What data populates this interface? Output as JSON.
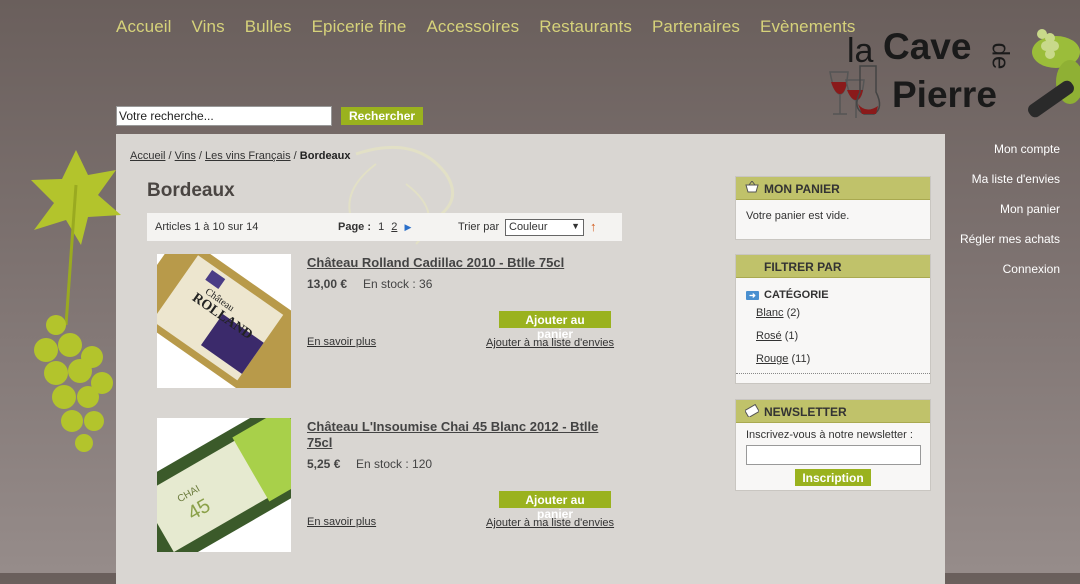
{
  "nav": [
    "Accueil",
    "Vins",
    "Bulles",
    "Epicerie fine",
    "Accessoires",
    "Restaurants",
    "Partenaires",
    "Evènements"
  ],
  "logo": {
    "la": "la",
    "cave": "Cave",
    "de": "de",
    "pierre": "Pierre"
  },
  "search": {
    "value": "Votre recherche...",
    "button": "Rechercher"
  },
  "account_menu": [
    "Mon compte",
    "Ma liste d'envies",
    "Mon panier",
    "Régler mes achats",
    "Connexion"
  ],
  "breadcrumb": {
    "items": [
      "Accueil",
      "Vins",
      "Les vins Français"
    ],
    "current": "Bordeaux"
  },
  "category_title": "Bordeaux",
  "pager": {
    "count_text": "Articles 1 à 10 sur 14",
    "page_label": "Page :",
    "current_page": "1",
    "next_page": "2",
    "sort_label": "Trier par",
    "sort_value": "Couleur"
  },
  "products": [
    {
      "title": "Château Rolland Cadillac 2010 - Btlle 75cl",
      "price": "13,00 €",
      "stock": "En stock : 36",
      "add": "Ajouter au panier",
      "more": "En savoir plus",
      "wish": "Ajouter à ma liste d'envies",
      "label_text": "ROLLAND",
      "label_sub": "Château"
    },
    {
      "title": "Château L'Insoumise Chai 45 Blanc 2012 - Btlle 75cl",
      "price": "5,25 €",
      "stock": "En stock : 120",
      "add": "Ajouter au panier",
      "more": "En savoir plus",
      "wish": "Ajouter à ma liste d'envies",
      "label_text": "CHAI",
      "label_sub": "45"
    }
  ],
  "cart": {
    "title": "MON PANIER",
    "empty": "Votre panier est vide."
  },
  "filter": {
    "title": "FILTRER PAR",
    "category": "CATÉGORIE",
    "items": [
      {
        "label": "Blanc",
        "count": "(2)"
      },
      {
        "label": "Rosé",
        "count": "(1)"
      },
      {
        "label": "Rouge",
        "count": "(11)"
      }
    ]
  },
  "newsletter": {
    "title": "NEWSLETTER",
    "text": "Inscrivez-vous à notre newsletter :",
    "button": "Inscription"
  },
  "colors": {
    "accent_green": "#9ab21e",
    "nav_text": "#d6d27a",
    "box_header": "#c0c26a"
  }
}
